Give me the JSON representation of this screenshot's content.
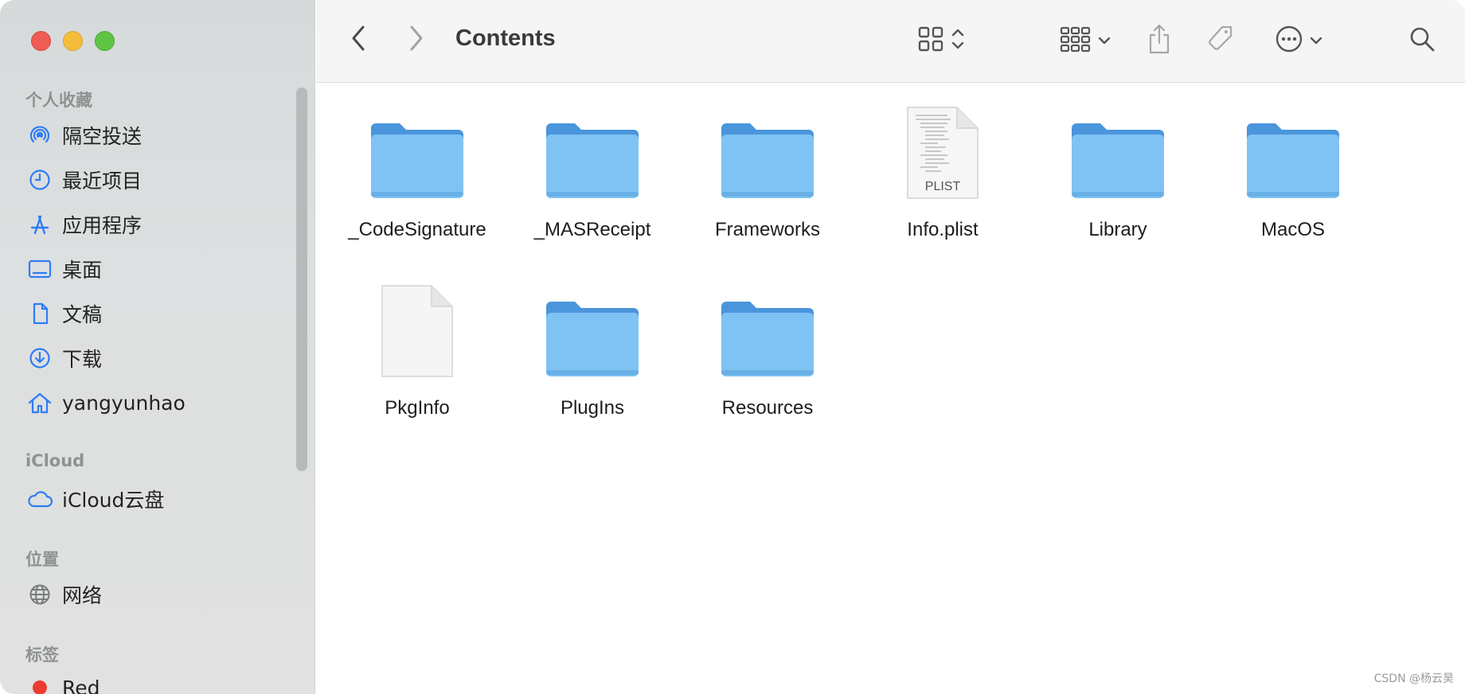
{
  "window": {
    "title": "Contents"
  },
  "sidebar": {
    "favorites_title": "个人收藏",
    "favorites": [
      {
        "label": "隔空投送",
        "icon": "airdrop-icon"
      },
      {
        "label": "最近项目",
        "icon": "clock-icon"
      },
      {
        "label": "应用程序",
        "icon": "applications-icon"
      },
      {
        "label": "桌面",
        "icon": "desktop-icon"
      },
      {
        "label": "文稿",
        "icon": "document-icon"
      },
      {
        "label": "下载",
        "icon": "download-icon"
      },
      {
        "label": "yangyunhao",
        "icon": "home-icon"
      }
    ],
    "icloud_title": "iCloud",
    "icloud": [
      {
        "label": "iCloud云盘",
        "icon": "cloud-icon"
      }
    ],
    "locations_title": "位置",
    "locations": [
      {
        "label": "网络",
        "icon": "globe-icon"
      }
    ],
    "tags_title": "标签",
    "tags": [
      {
        "label": "Red",
        "color": "#ee3b30"
      }
    ]
  },
  "files": [
    {
      "name": "_CodeSignature",
      "kind": "folder"
    },
    {
      "name": "_MASReceipt",
      "kind": "folder"
    },
    {
      "name": "Frameworks",
      "kind": "folder"
    },
    {
      "name": "Info.plist",
      "kind": "plist",
      "badge": "PLIST"
    },
    {
      "name": "Library",
      "kind": "folder"
    },
    {
      "name": "MacOS",
      "kind": "folder"
    },
    {
      "name": "PkgInfo",
      "kind": "file"
    },
    {
      "name": "PlugIns",
      "kind": "folder"
    },
    {
      "name": "Resources",
      "kind": "folder"
    }
  ],
  "watermark": "CSDN @杨云昊",
  "colors": {
    "accent": "#2f7bf6",
    "folder": "#7cc1f2"
  }
}
